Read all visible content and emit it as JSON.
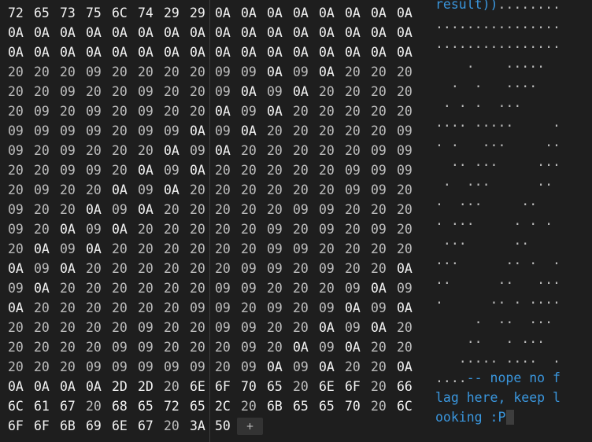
{
  "hex_rows": [
    [
      "72",
      "65",
      "73",
      "75",
      "6C",
      "74",
      "29",
      "29",
      "0A",
      "0A",
      "0A",
      "0A",
      "0A",
      "0A",
      "0A",
      "0A"
    ],
    [
      "0A",
      "0A",
      "0A",
      "0A",
      "0A",
      "0A",
      "0A",
      "0A",
      "0A",
      "0A",
      "0A",
      "0A",
      "0A",
      "0A",
      "0A",
      "0A"
    ],
    [
      "0A",
      "0A",
      "0A",
      "0A",
      "0A",
      "0A",
      "0A",
      "0A",
      "0A",
      "0A",
      "0A",
      "0A",
      "0A",
      "0A",
      "0A",
      "0A"
    ],
    [
      "20",
      "20",
      "20",
      "09",
      "20",
      "20",
      "20",
      "20",
      "09",
      "09",
      "0A",
      "09",
      "0A",
      "20",
      "20",
      "20"
    ],
    [
      "20",
      "20",
      "09",
      "20",
      "20",
      "09",
      "20",
      "20",
      "09",
      "0A",
      "09",
      "0A",
      "20",
      "20",
      "20",
      "20"
    ],
    [
      "20",
      "09",
      "20",
      "09",
      "20",
      "09",
      "20",
      "20",
      "0A",
      "09",
      "0A",
      "20",
      "20",
      "20",
      "20",
      "20"
    ],
    [
      "09",
      "09",
      "09",
      "09",
      "20",
      "09",
      "09",
      "0A",
      "09",
      "0A",
      "20",
      "20",
      "20",
      "20",
      "20",
      "09"
    ],
    [
      "09",
      "20",
      "09",
      "20",
      "20",
      "20",
      "0A",
      "09",
      "0A",
      "20",
      "20",
      "20",
      "20",
      "20",
      "09",
      "09"
    ],
    [
      "20",
      "20",
      "09",
      "09",
      "20",
      "0A",
      "09",
      "0A",
      "20",
      "20",
      "20",
      "20",
      "20",
      "09",
      "09",
      "09"
    ],
    [
      "20",
      "09",
      "20",
      "20",
      "0A",
      "09",
      "0A",
      "20",
      "20",
      "20",
      "20",
      "20",
      "20",
      "09",
      "09",
      "20"
    ],
    [
      "09",
      "20",
      "20",
      "0A",
      "09",
      "0A",
      "20",
      "20",
      "20",
      "20",
      "20",
      "09",
      "09",
      "20",
      "20",
      "20"
    ],
    [
      "09",
      "20",
      "0A",
      "09",
      "0A",
      "20",
      "20",
      "20",
      "20",
      "20",
      "09",
      "20",
      "09",
      "20",
      "09",
      "20"
    ],
    [
      "20",
      "0A",
      "09",
      "0A",
      "20",
      "20",
      "20",
      "20",
      "20",
      "20",
      "09",
      "09",
      "20",
      "20",
      "20",
      "20"
    ],
    [
      "0A",
      "09",
      "0A",
      "20",
      "20",
      "20",
      "20",
      "20",
      "20",
      "09",
      "09",
      "20",
      "09",
      "20",
      "20",
      "0A"
    ],
    [
      "09",
      "0A",
      "20",
      "20",
      "20",
      "20",
      "20",
      "20",
      "09",
      "09",
      "20",
      "20",
      "20",
      "09",
      "0A",
      "09"
    ],
    [
      "0A",
      "20",
      "20",
      "20",
      "20",
      "20",
      "20",
      "09",
      "09",
      "20",
      "09",
      "20",
      "09",
      "0A",
      "09",
      "0A"
    ],
    [
      "20",
      "20",
      "20",
      "20",
      "20",
      "09",
      "20",
      "20",
      "09",
      "09",
      "20",
      "20",
      "0A",
      "09",
      "0A",
      "20"
    ],
    [
      "20",
      "20",
      "20",
      "20",
      "09",
      "09",
      "20",
      "20",
      "20",
      "09",
      "20",
      "0A",
      "09",
      "0A",
      "20",
      "20"
    ],
    [
      "20",
      "20",
      "20",
      "09",
      "09",
      "09",
      "09",
      "09",
      "20",
      "09",
      "0A",
      "09",
      "0A",
      "20",
      "20",
      "0A"
    ],
    [
      "0A",
      "0A",
      "0A",
      "0A",
      "2D",
      "2D",
      "20",
      "6E",
      "6F",
      "70",
      "65",
      "20",
      "6E",
      "6F",
      "20",
      "66"
    ],
    [
      "6C",
      "61",
      "67",
      "20",
      "68",
      "65",
      "72",
      "65",
      "2C",
      "20",
      "6B",
      "65",
      "65",
      "70",
      "20",
      "6C"
    ],
    [
      "6F",
      "6F",
      "6B",
      "69",
      "6E",
      "67",
      "20",
      "3A",
      "50"
    ]
  ],
  "ascii_rows": [
    {
      "str": "result))",
      "dots": "........"
    },
    {
      "str": "",
      "dots": "................"
    },
    {
      "str": "",
      "dots": "................"
    },
    {
      "str": "",
      "dots": "    .    .....  "
    },
    {
      "str": "",
      "dots": "  .  .   ....   "
    },
    {
      "str": "",
      "dots": " . . .  ...     "
    },
    {
      "str": "",
      "dots": ".... .....     ."
    },
    {
      "str": "",
      "dots": ". .   ...     .."
    },
    {
      "str": "",
      "dots": "  .. ...     ..."
    },
    {
      "str": "",
      "dots": " .  ...      .. "
    },
    {
      "str": "",
      "dots": ".  ...     ..   "
    },
    {
      "str": "",
      "dots": ". ...     . . . "
    },
    {
      "str": "",
      "dots": " ...      ..    "
    },
    {
      "str": "",
      "dots": "...      .. .  ."
    },
    {
      "str": "",
      "dots": "..      ..   ..."
    },
    {
      "str": "",
      "dots": ".      .. . ...."
    },
    {
      "str": "",
      "dots": "     .  ..  ... "
    },
    {
      "str": "",
      "dots": "    ..   . ...  "
    },
    {
      "str": "",
      "dots": "   ..... ....  ."
    },
    {
      "prefix": "....",
      "str": "-- nope no f",
      "dots": ""
    },
    {
      "str": "lag here, keep l",
      "dots": ""
    },
    {
      "str": "ooking :P",
      "dots": ""
    }
  ],
  "add_button_label": "+"
}
